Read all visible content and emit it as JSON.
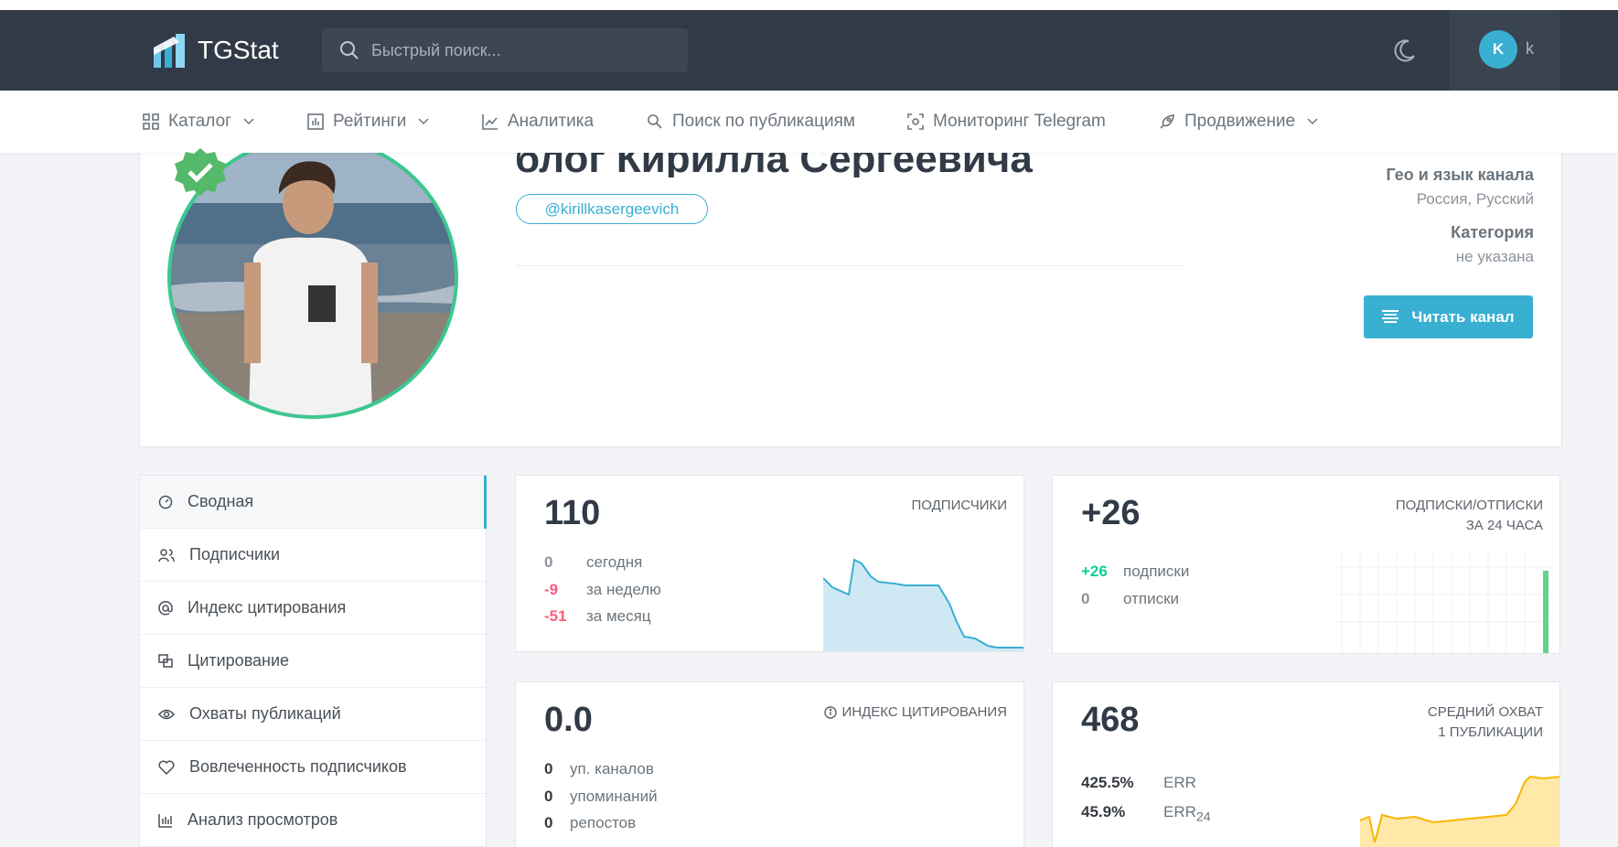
{
  "header": {
    "logo_text": "TGStat",
    "search_placeholder": "Быстрый поиск...",
    "user_initial": "K",
    "user_name": "k"
  },
  "menu": [
    {
      "label": "Каталог",
      "icon": "grid-icon",
      "dropdown": true
    },
    {
      "label": "Рейтинги",
      "icon": "bar-chart-icon",
      "dropdown": true
    },
    {
      "label": "Аналитика",
      "icon": "line-chart-icon",
      "dropdown": false
    },
    {
      "label": "Поиск по публикациям",
      "icon": "search-icon",
      "dropdown": false
    },
    {
      "label": "Мониторинг Telegram",
      "icon": "monitoring-icon",
      "dropdown": false
    },
    {
      "label": "Продвижение",
      "icon": "rocket-icon",
      "dropdown": true
    }
  ],
  "channel": {
    "title": "блог Кирилла Сергеевича",
    "handle": "@kirillkasergeevich",
    "geo_label": "Гео и язык канала",
    "geo_value": "Россия, Русский",
    "category_label": "Категория",
    "category_value": "не указана",
    "read_button": "Читать канал"
  },
  "sidebar": [
    {
      "label": "Сводная",
      "icon": "dashboard-icon",
      "active": true
    },
    {
      "label": "Подписчики",
      "icon": "users-icon"
    },
    {
      "label": "Индекс цитирования",
      "icon": "at-icon"
    },
    {
      "label": "Цитирование",
      "icon": "quote-icon"
    },
    {
      "label": "Охваты публикаций",
      "icon": "eye-icon"
    },
    {
      "label": "Вовлеченность подписчиков",
      "icon": "engagement-icon"
    },
    {
      "label": "Анализ просмотров",
      "icon": "views-chart-icon"
    }
  ],
  "cards": {
    "subscribers": {
      "value": "110",
      "label": "ПОДПИСЧИКИ",
      "rows": [
        {
          "n": "0",
          "t": "сегодня",
          "color": "#8a929a"
        },
        {
          "n": "-9",
          "t": "за неделю",
          "color": "#fa5c7c"
        },
        {
          "n": "-51",
          "t": "за месяц",
          "color": "#fa5c7c"
        }
      ]
    },
    "subs_unsubs": {
      "value": "+26",
      "label_line1": "ПОДПИСКИ/ОТПИСКИ",
      "label_line2": "ЗА 24 ЧАСА",
      "rows": [
        {
          "n": "+26",
          "t": "подписки",
          "color": "#0acf97"
        },
        {
          "n": "0",
          "t": "отписки",
          "color": "#8a929a"
        }
      ]
    },
    "citation": {
      "value": "0.0",
      "label": "ИНДЕКС ЦИТИРОВАНИЯ",
      "rows": [
        {
          "n": "0",
          "t": "уп. каналов"
        },
        {
          "n": "0",
          "t": "упоминаний"
        },
        {
          "n": "0",
          "t": "репостов"
        }
      ]
    },
    "reach": {
      "value": "468",
      "label_line1": "СРЕДНИЙ ОХВАТ",
      "label_line2": "1 ПУБЛИКАЦИИ",
      "rows": [
        {
          "n": "425.5%",
          "t": "ERR"
        },
        {
          "n": "45.9%",
          "t": "ERR",
          "sub": "24"
        }
      ]
    }
  },
  "colors": {
    "topbar": "#313a46",
    "accent": "#39afd1",
    "success": "#0acf97",
    "danger": "#fa5c7c",
    "warning": "#ffbc00"
  }
}
